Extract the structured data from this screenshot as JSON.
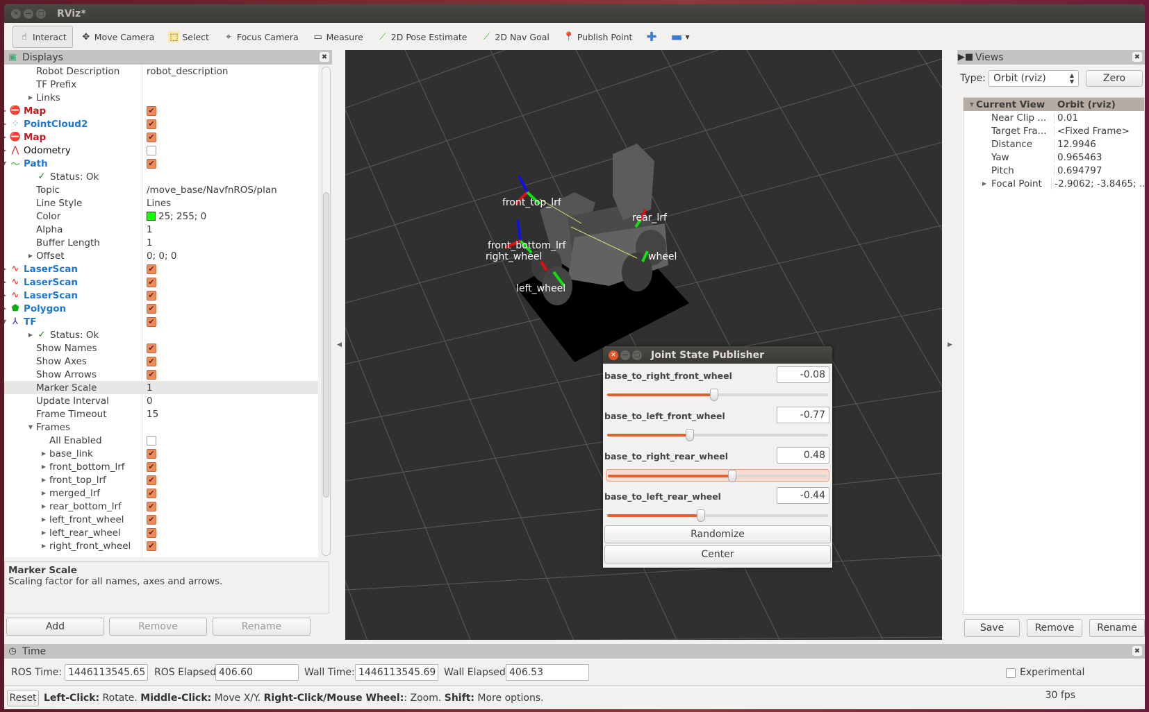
{
  "window": {
    "title": "RViz*"
  },
  "toolbar": [
    {
      "label": "Interact",
      "icon": "hand-icon",
      "active": true
    },
    {
      "label": "Move Camera",
      "icon": "move-camera-icon"
    },
    {
      "label": "Select",
      "icon": "select-icon"
    },
    {
      "label": "Focus Camera",
      "icon": "focus-camera-icon"
    },
    {
      "label": "Measure",
      "icon": "ruler-icon"
    },
    {
      "label": "2D Pose Estimate",
      "icon": "green-arrow-icon"
    },
    {
      "label": "2D Nav Goal",
      "icon": "green-arrow-icon"
    },
    {
      "label": "Publish Point",
      "icon": "map-pin-icon"
    }
  ],
  "displays": {
    "title": "Displays",
    "rows": [
      {
        "name": "Robot Description",
        "value": "robot_description",
        "indent": 2
      },
      {
        "name": "TF Prefix",
        "value": "",
        "indent": 2
      },
      {
        "name": "Links",
        "value": "",
        "indent": 2,
        "exp": "closed"
      },
      {
        "name": "Map",
        "indent": 0,
        "exp": "closed",
        "icon": "error-icon",
        "style": "red",
        "check": true
      },
      {
        "name": "PointCloud2",
        "indent": 0,
        "exp": "closed",
        "icon": "pointcloud-icon",
        "style": "blue",
        "check": true
      },
      {
        "name": "Map",
        "indent": 0,
        "exp": "closed",
        "icon": "error-icon",
        "style": "red",
        "check": true
      },
      {
        "name": "Odometry",
        "indent": 0,
        "exp": "closed",
        "icon": "odometry-icon",
        "style": "black",
        "check": false
      },
      {
        "name": "Path",
        "indent": 0,
        "exp": "open",
        "icon": "path-icon",
        "style": "blue",
        "check": true
      },
      {
        "name": "Status: Ok",
        "indent": 2,
        "icon": "checkmark-icon"
      },
      {
        "name": "Topic",
        "value": "/move_base/NavfnROS/plan",
        "indent": 2
      },
      {
        "name": "Line Style",
        "value": "Lines",
        "indent": 2
      },
      {
        "name": "Color",
        "value": "25; 255; 0",
        "indent": 2,
        "swatch": "#19ff00"
      },
      {
        "name": "Alpha",
        "value": "1",
        "indent": 2
      },
      {
        "name": "Buffer Length",
        "value": "1",
        "indent": 2
      },
      {
        "name": "Offset",
        "value": "0; 0; 0",
        "indent": 2,
        "exp": "closed"
      },
      {
        "name": "LaserScan",
        "indent": 0,
        "exp": "closed",
        "icon": "laserscan-icon",
        "style": "blue",
        "check": true
      },
      {
        "name": "LaserScan",
        "indent": 0,
        "exp": "closed",
        "icon": "laserscan-icon",
        "style": "blue",
        "check": true
      },
      {
        "name": "LaserScan",
        "indent": 0,
        "exp": "closed",
        "icon": "laserscan-icon",
        "style": "blue",
        "check": true
      },
      {
        "name": "Polygon",
        "indent": 0,
        "exp": "closed",
        "icon": "polygon-icon",
        "style": "blue",
        "check": true
      },
      {
        "name": "TF",
        "indent": 0,
        "exp": "open",
        "icon": "tf-axes-icon",
        "style": "blue",
        "check": true
      },
      {
        "name": "Status: Ok",
        "indent": 2,
        "exp": "closed",
        "icon": "checkmark-icon"
      },
      {
        "name": "Show Names",
        "indent": 2,
        "check": true
      },
      {
        "name": "Show Axes",
        "indent": 2,
        "check": true
      },
      {
        "name": "Show Arrows",
        "indent": 2,
        "check": true
      },
      {
        "name": "Marker Scale",
        "value": "1",
        "indent": 2,
        "selected": true
      },
      {
        "name": "Update Interval",
        "value": "0",
        "indent": 2
      },
      {
        "name": "Frame Timeout",
        "value": "15",
        "indent": 2
      },
      {
        "name": "Frames",
        "indent": 2,
        "exp": "open"
      },
      {
        "name": "All Enabled",
        "indent": 3,
        "check": false
      },
      {
        "name": "base_link",
        "indent": 3,
        "exp": "closed",
        "check": true
      },
      {
        "name": "front_bottom_lrf",
        "indent": 3,
        "exp": "closed",
        "check": true
      },
      {
        "name": "front_top_lrf",
        "indent": 3,
        "exp": "closed",
        "check": true
      },
      {
        "name": "merged_lrf",
        "indent": 3,
        "exp": "closed",
        "check": true
      },
      {
        "name": "rear_bottom_lrf",
        "indent": 3,
        "exp": "closed",
        "check": true
      },
      {
        "name": "left_front_wheel",
        "indent": 3,
        "exp": "closed",
        "check": true
      },
      {
        "name": "left_rear_wheel",
        "indent": 3,
        "exp": "closed",
        "check": true
      },
      {
        "name": "right_front_wheel",
        "indent": 3,
        "exp": "closed",
        "check": true
      }
    ],
    "description_title": "Marker Scale",
    "description_text": "Scaling factor for all names, axes and arrows.",
    "buttons": {
      "add": "Add",
      "remove": "Remove",
      "rename": "Rename"
    }
  },
  "viewport": {
    "frame_labels": [
      "front_top_lrf",
      "rear_lrf",
      "front_bottom_lrf",
      "right_wheel",
      "left_wheel",
      "wheel"
    ]
  },
  "joint_state_publisher": {
    "title": "Joint State Publisher",
    "joints": [
      {
        "name": "base_to_right_front_wheel",
        "value": "-0.08",
        "fraction": 0.49
      },
      {
        "name": "base_to_left_front_wheel",
        "value": "-0.77",
        "fraction": 0.38
      },
      {
        "name": "base_to_right_rear_wheel",
        "value": "0.48",
        "fraction": 0.57,
        "highlight": true
      },
      {
        "name": "base_to_left_rear_wheel",
        "value": "-0.44",
        "fraction": 0.43
      }
    ],
    "randomize": "Randomize",
    "center": "Center"
  },
  "views": {
    "title": "Views",
    "type_label": "Type:",
    "type_value": "Orbit (rviz)",
    "zero": "Zero",
    "header": {
      "name": "Current View",
      "value": "Orbit (rviz)"
    },
    "rows": [
      {
        "name": "Near Clip ...",
        "value": "0.01"
      },
      {
        "name": "Target Fra...",
        "value": "<Fixed Frame>"
      },
      {
        "name": "Distance",
        "value": "12.9946"
      },
      {
        "name": "Yaw",
        "value": "0.965463"
      },
      {
        "name": "Pitch",
        "value": "0.694797"
      },
      {
        "name": "Focal Point",
        "value": "-2.9062; -3.8465; ...",
        "exp": "closed"
      }
    ],
    "buttons": {
      "save": "Save",
      "remove": "Remove",
      "rename": "Rename"
    }
  },
  "time": {
    "title": "Time",
    "ros_time_label": "ROS Time:",
    "ros_time": "1446113545.65",
    "ros_elapsed_label": "ROS Elapsed:",
    "ros_elapsed": "406.60",
    "wall_time_label": "Wall Time:",
    "wall_time": "1446113545.69",
    "wall_elapsed_label": "Wall Elapsed:",
    "wall_elapsed": "406.53",
    "experimental": "Experimental"
  },
  "status": {
    "reset": "Reset",
    "hint": [
      [
        "Left-Click:",
        " Rotate. "
      ],
      [
        "Middle-Click:",
        " Move X/Y. "
      ],
      [
        "Right-Click/Mouse Wheel:",
        ": Zoom. "
      ],
      [
        "Shift:",
        " More options."
      ]
    ],
    "fps": "30 fps"
  }
}
